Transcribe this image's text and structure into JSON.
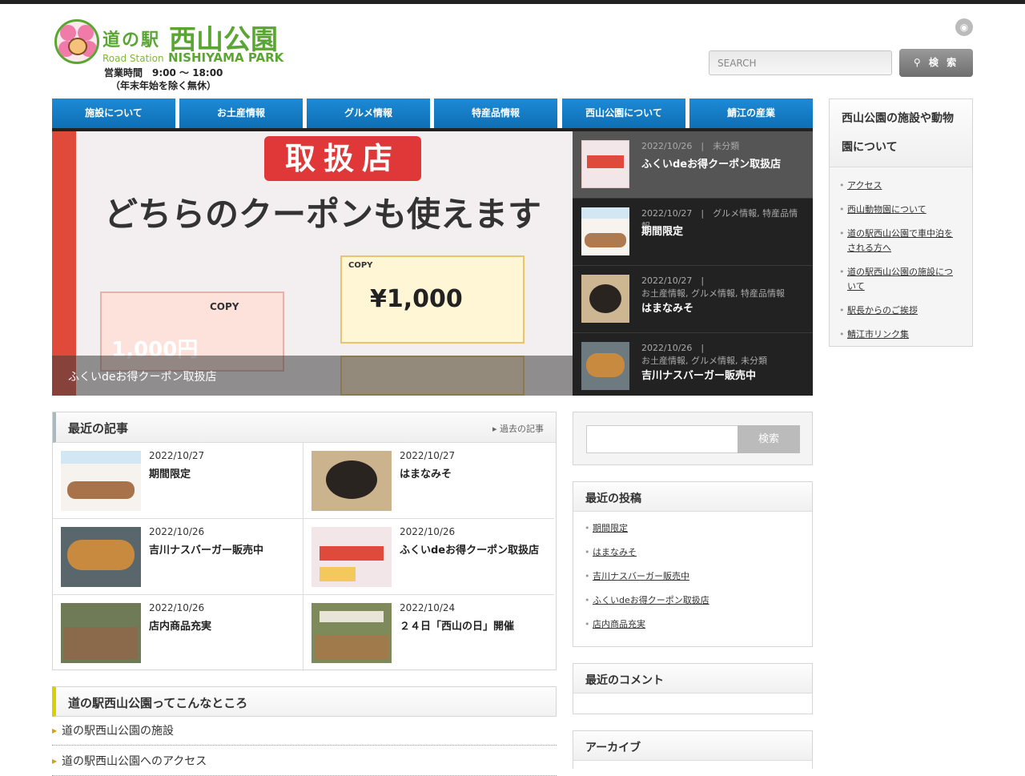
{
  "site": {
    "logo_text": "道の駅",
    "logo_name": "西山公園",
    "logo_sub_left": "Road Station",
    "logo_sub_right": "NISHIYAMA PARK",
    "hours": "営業時間　9:00 〜 18:00",
    "holidays": "（年末年始を除く無休）"
  },
  "header": {
    "search_placeholder": "SEARCH",
    "search_button": "検 索"
  },
  "nav": [
    "施設について",
    "お土産情報",
    "グルメ情報",
    "特産品情報",
    "西山公園について",
    "鯖江の産業"
  ],
  "slider": {
    "banner_shop": "取扱店",
    "banner_text": "どちらのクーポンも使えます",
    "coupon_amount": "¥1,000",
    "coupon_amount_small": "1,000円",
    "coupon_copy": "COPY",
    "caption": "ふくいdeお得クーポン取扱店"
  },
  "featured": [
    {
      "date": "2022/10/26",
      "sep": "|",
      "cats": "未分類",
      "title": "ふくいdeお得クーポン取扱店"
    },
    {
      "date": "2022/10/27",
      "sep": "|",
      "cats": "グルメ情報, 特産品情報",
      "title": "期間限定"
    },
    {
      "date": "2022/10/27",
      "sep": "|",
      "cats": "お土産情報, グルメ情報, 特産品情報",
      "title": "はまなみそ"
    },
    {
      "date": "2022/10/26",
      "sep": "|",
      "cats": "お土産情報, グルメ情報, 未分類",
      "title": "吉川ナスバーガー販売中"
    }
  ],
  "recent": {
    "heading": "最近の記事",
    "more": "過去の記事",
    "posts": [
      {
        "date": "2022/10/27",
        "title": "期間限定"
      },
      {
        "date": "2022/10/27",
        "title": "はまなみそ"
      },
      {
        "date": "2022/10/26",
        "title": "吉川ナスバーガー販売中"
      },
      {
        "date": "2022/10/26",
        "title": "ふくいdeお得クーポン取扱店"
      },
      {
        "date": "2022/10/26",
        "title": "店内商品充実"
      },
      {
        "date": "2022/10/24",
        "title": "２４日「西山の日」開催"
      }
    ]
  },
  "about": {
    "heading": "道の駅西山公園ってこんなところ",
    "links": [
      "道の駅西山公園の施設",
      "道の駅西山公園へのアクセス"
    ]
  },
  "side_search": {
    "button": "検索"
  },
  "recent_posts": {
    "heading": "最近の投稿",
    "items": [
      "期間限定",
      "はまなみそ",
      "吉川ナスバーガー販売中",
      "ふくいdeお得クーポン取扱店",
      "店内商品充実"
    ]
  },
  "recent_comments": {
    "heading": "最近のコメント"
  },
  "archive": {
    "heading": "アーカイブ"
  },
  "right_sidebar": {
    "heading_line1": "西山公園の施設や動物",
    "heading_line2": "園について",
    "items": [
      "アクセス",
      "西山動物園について",
      "道の駅西山公園で車中泊を",
      "される方へ",
      "道の駅西山公園の施設につ",
      "いて",
      "駅長からのご挨拶",
      "鯖江市リンク集"
    ]
  },
  "colors": {
    "nav_blue": "#1d8ad6",
    "accent_green": "#5aa632",
    "dark_panel": "#222222"
  }
}
